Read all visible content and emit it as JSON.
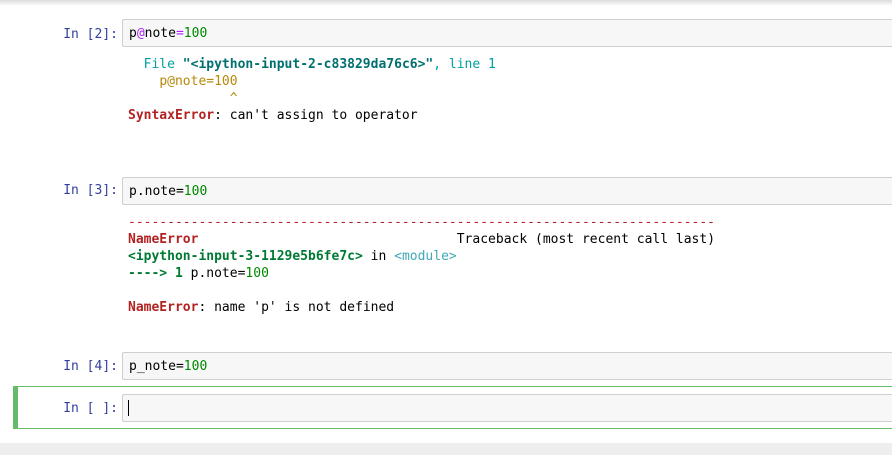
{
  "cells": [
    {
      "prompt": "In [2]:",
      "code": {
        "a": "p",
        "b": "@",
        "c": "note",
        "d": "=",
        "e": "100"
      },
      "output": {
        "file_prefix": "File ",
        "file_name": "\"<ipython-input-2-c83829da76c6>\"",
        "file_sep": ", line ",
        "file_line": "1",
        "src_line": "p@note=100",
        "caret": "^",
        "error_name": "SyntaxError",
        "error_msg": ": can't assign to operator"
      }
    },
    {
      "prompt": "In [3]:",
      "code": {
        "a": "p.note=",
        "e": "100"
      },
      "output": {
        "dashes": "---------------------------------------------------------------------------",
        "error_name": "NameError",
        "traceback_label": "Traceback (most recent call last)",
        "input_ref": "<ipython-input-3-1129e5b6fe7c>",
        "in_word": " in ",
        "module": "<module>",
        "arrow": "----> 1 ",
        "arrow_code_a": "p.note=",
        "arrow_code_b": "100",
        "final_error_name": "NameError",
        "final_error_msg": ": name 'p' is not defined"
      }
    },
    {
      "prompt": "In [4]:",
      "code": {
        "a": "p_note=",
        "e": "100"
      }
    },
    {
      "prompt": "In [ ]:",
      "code": {
        "a": ""
      }
    }
  ]
}
